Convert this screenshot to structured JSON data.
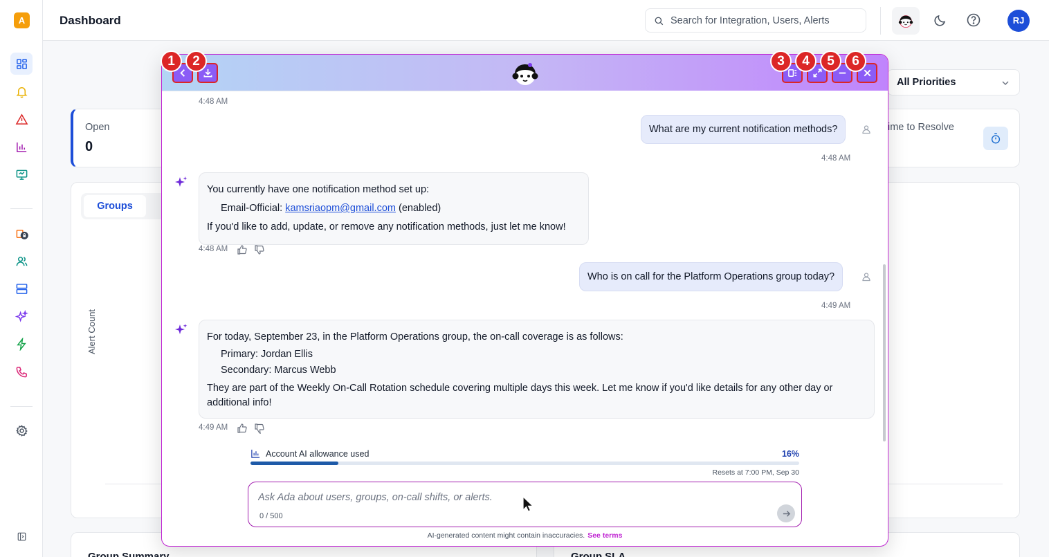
{
  "app": {
    "logo_text": "A",
    "brand_color": "#f59e0b"
  },
  "header": {
    "title": "Dashboard",
    "search_placeholder": "Search for Integration, Users, Alerts",
    "user_initials": "RJ"
  },
  "sidebar": {
    "items": [
      {
        "name": "dashboard",
        "icon": "dashboard-icon",
        "active": true
      },
      {
        "name": "notifications",
        "icon": "bell-icon"
      },
      {
        "name": "alerts",
        "icon": "warning-icon"
      },
      {
        "name": "analytics",
        "icon": "bar-chart-icon"
      },
      {
        "name": "monitor",
        "icon": "monitor-icon"
      },
      {
        "name": "integrations",
        "icon": "integrations-lock-icon"
      },
      {
        "name": "users",
        "icon": "users-icon"
      },
      {
        "name": "services",
        "icon": "server-icon"
      },
      {
        "name": "ai",
        "icon": "sparkles-icon"
      },
      {
        "name": "automation",
        "icon": "lightning-icon"
      },
      {
        "name": "calls",
        "icon": "phone-icon"
      },
      {
        "name": "settings",
        "icon": "gear-icon"
      },
      {
        "name": "collapse",
        "icon": "sidebar-toggle-icon"
      }
    ]
  },
  "dashboard": {
    "priority_filter": "All Priorities",
    "open_label": "Open",
    "open_value": "0",
    "time_to_resolve_label": "ime to Resolve",
    "tab_groups": "Groups",
    "y_axis_label": "Alert Count",
    "bottom_left_title": "Group Summary",
    "bottom_right_title": "Group SLA"
  },
  "chat": {
    "header_badges": [
      "1",
      "2",
      "3",
      "4",
      "5",
      "6"
    ],
    "messages": [
      {
        "role": "time",
        "time": "4:48 AM"
      },
      {
        "role": "user",
        "text": "What are my current notification methods?",
        "time": "4:48 AM"
      },
      {
        "role": "assistant",
        "line1": "You currently have one notification method set up:",
        "line2_prefix": "Email-Official: ",
        "line2_link": "kamsriaopm@gmail.com",
        "line2_suffix": " (enabled)",
        "line3": "If you'd like to add, update, or remove any notification methods, just let me know!",
        "time": "4:48 AM"
      },
      {
        "role": "user",
        "text": "Who is on call for the Platform Operations group today?",
        "time": "4:49 AM"
      },
      {
        "role": "assistant",
        "line1": "For today, September 23, in the Platform Operations group, the on-call coverage is as follows:",
        "line2": "Primary: Jordan Ellis",
        "line3": "Secondary: Marcus Webb",
        "line4": "They are part of the Weekly On-Call Rotation schedule covering multiple days this week. Let me know if you'd like details for any other day or additional info!",
        "time": "4:49 AM"
      }
    ],
    "allowance": {
      "label": "Account AI allowance used",
      "percent_text": "16%",
      "percent": 16,
      "reset_text": "Resets at 7:00 PM, Sep 30"
    },
    "input": {
      "placeholder": "Ask Ada about users, groups, on-call shifts, or alerts.",
      "counter": "0 / 500"
    },
    "disclaimer": "AI-generated content might contain inaccuracies.",
    "terms_link": "See terms"
  }
}
